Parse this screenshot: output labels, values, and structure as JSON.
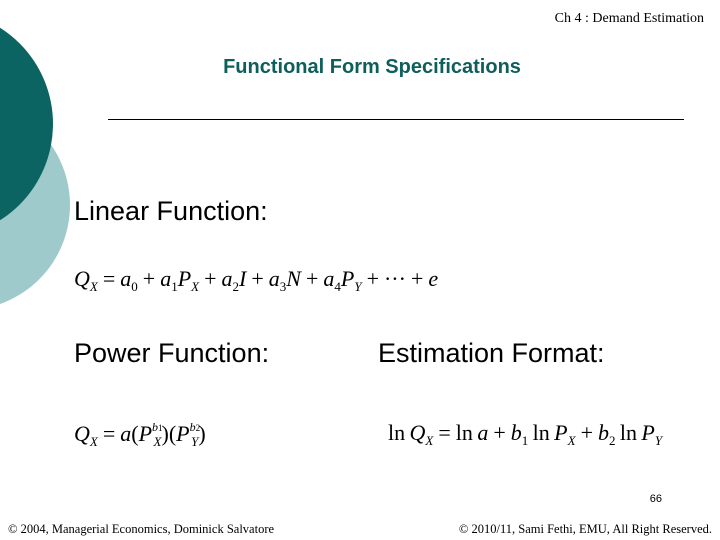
{
  "header": {
    "chapter": "Ch 4 : Demand Estimation"
  },
  "title": "Functional Form Specifications",
  "sections": {
    "linear": {
      "label": "Linear Function:",
      "equation": "Q_X = a_0 + a_1 P_X + a_2 I + a_3 N + a_4 P_Y + ⋯ + e"
    },
    "power": {
      "label": "Power Function:",
      "equation": "Q_X = a(P_X^{b_1})(P_Y^{b_2})"
    },
    "estimation": {
      "label": "Estimation Format:",
      "equation": "ln Q_X = ln a + b_1 ln P_X + b_2 ln P_Y"
    }
  },
  "page_number": "66",
  "footer": {
    "left": "© 2004,  Managerial Economics, Dominick Salvatore",
    "right": "© 2010/11, Sami Fethi, EMU, All Right Reserved."
  },
  "colors": {
    "accent_dark": "#0b6462",
    "accent_light": "#9ecacb",
    "title": "#0e5f5c"
  }
}
